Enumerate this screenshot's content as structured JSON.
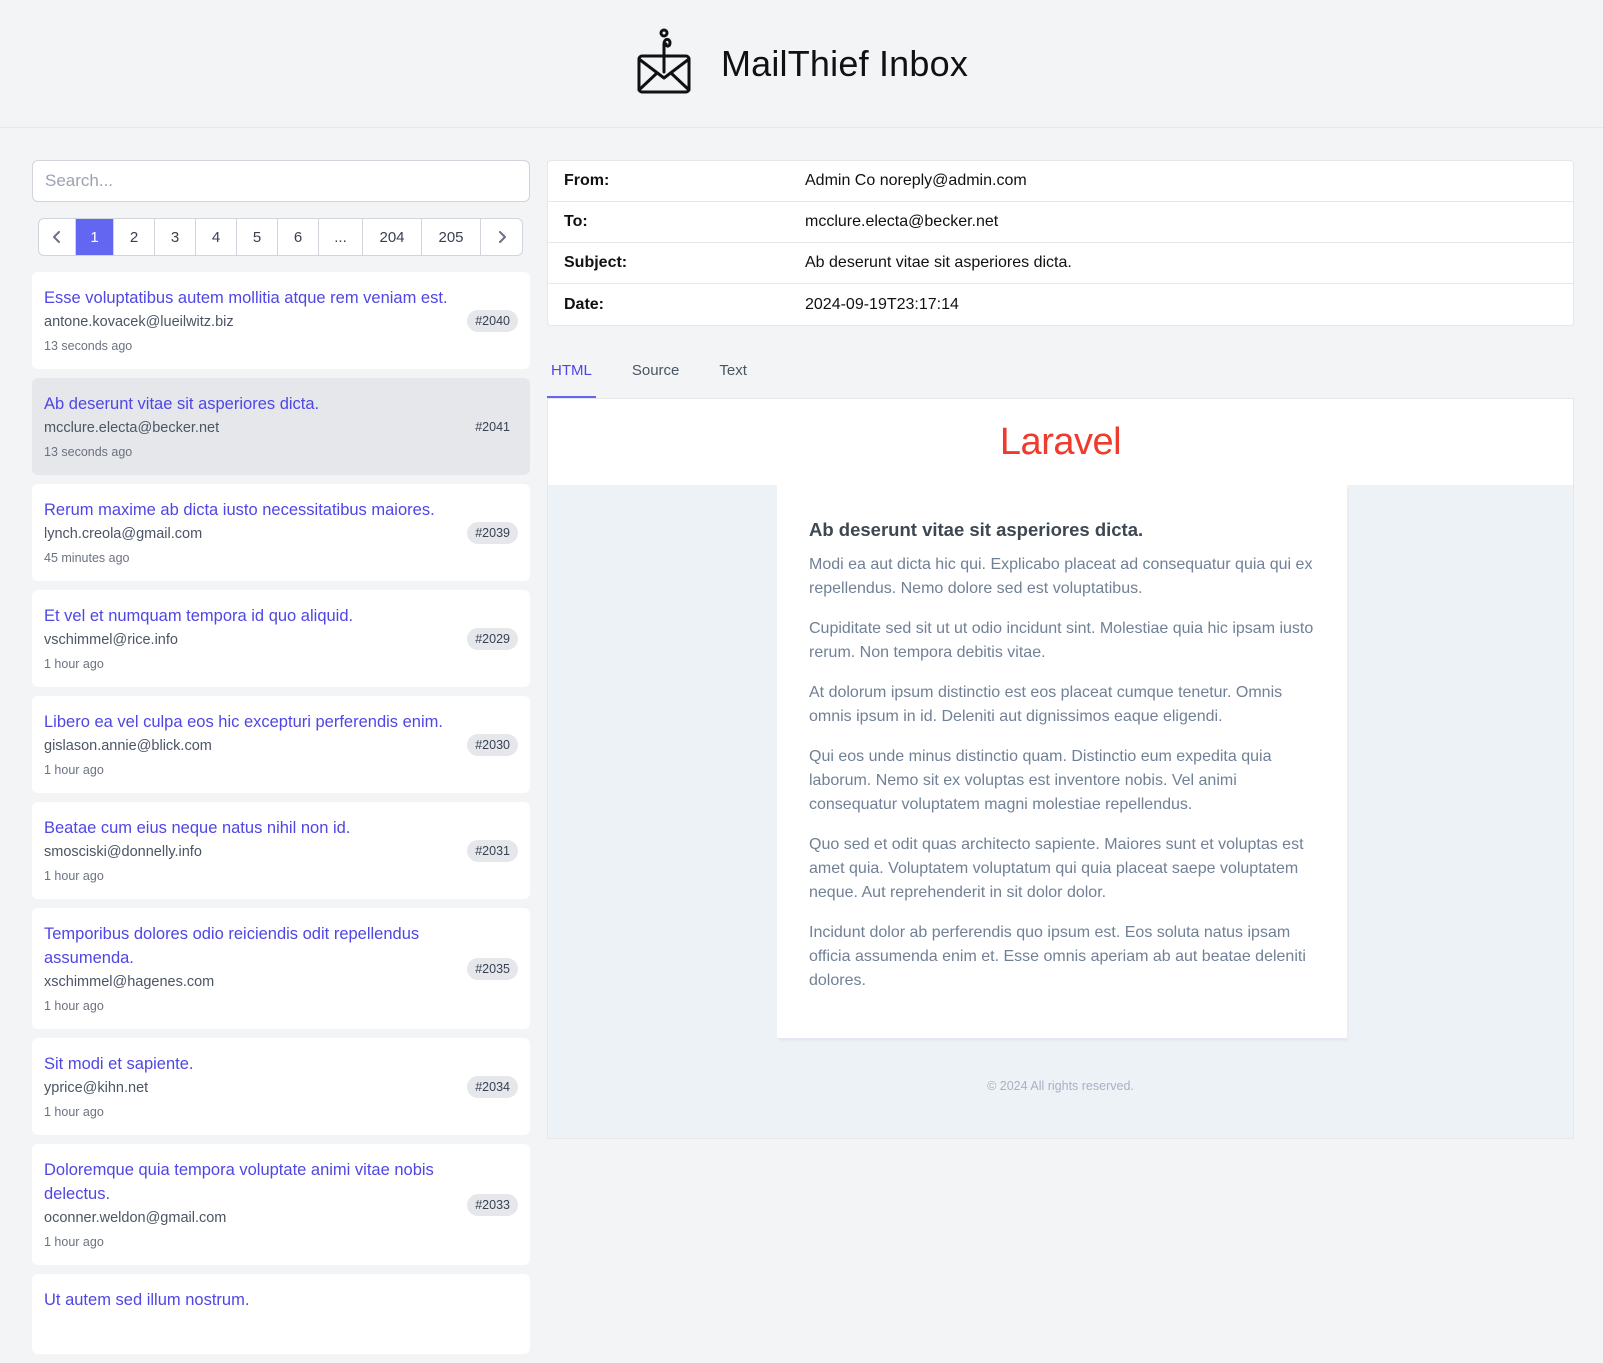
{
  "app": {
    "title": "MailThief Inbox"
  },
  "search": {
    "placeholder": "Search..."
  },
  "pagination": {
    "prev": "‹",
    "next": "›",
    "pages": [
      "1",
      "2",
      "3",
      "4",
      "5",
      "6",
      "...",
      "204",
      "205"
    ],
    "current": "1"
  },
  "mails": [
    {
      "subject": "Esse voluptatibus autem mollitia atque rem veniam est.",
      "from": "antone.kovacek@lueilwitz.biz",
      "time": "13 seconds ago",
      "id": "#2040"
    },
    {
      "subject": "Ab deserunt vitae sit asperiores dicta.",
      "from": "mcclure.electa@becker.net",
      "time": "13 seconds ago",
      "id": "#2041"
    },
    {
      "subject": "Rerum maxime ab dicta iusto necessitatibus maiores.",
      "from": "lynch.creola@gmail.com",
      "time": "45 minutes ago",
      "id": "#2039"
    },
    {
      "subject": "Et vel et numquam tempora id quo aliquid.",
      "from": "vschimmel@rice.info",
      "time": "1 hour ago",
      "id": "#2029"
    },
    {
      "subject": "Libero ea vel culpa eos hic excepturi perferendis enim.",
      "from": "gislason.annie@blick.com",
      "time": "1 hour ago",
      "id": "#2030"
    },
    {
      "subject": "Beatae cum eius neque natus nihil non id.",
      "from": "smosciski@donnelly.info",
      "time": "1 hour ago",
      "id": "#2031"
    },
    {
      "subject": "Temporibus dolores odio reiciendis odit repellendus assumenda.",
      "from": "xschimmel@hagenes.com",
      "time": "1 hour ago",
      "id": "#2035"
    },
    {
      "subject": "Sit modi et sapiente.",
      "from": "yprice@kihn.net",
      "time": "1 hour ago",
      "id": "#2034"
    },
    {
      "subject": "Doloremque quia tempora voluptate animi vitae nobis delectus.",
      "from": "oconner.weldon@gmail.com",
      "time": "1 hour ago",
      "id": "#2033"
    },
    {
      "subject": "Ut autem sed illum nostrum.",
      "from": "",
      "time": "",
      "id": ""
    }
  ],
  "message": {
    "from_label": "From:",
    "from": "Admin Co noreply@admin.com",
    "to_label": "To:",
    "to": "mcclure.electa@becker.net",
    "subject_label": "Subject:",
    "subject": "Ab deserunt vitae sit asperiores dicta.",
    "date_label": "Date:",
    "date": "2024-09-19T23:17:14"
  },
  "tabs": [
    "HTML",
    "Source",
    "Text"
  ],
  "preview": {
    "brand": "Laravel",
    "heading": "Ab deserunt vitae sit asperiores dicta.",
    "paragraphs": [
      "Modi ea aut dicta hic qui. Explicabo placeat ad consequatur quia qui ex repellendus. Nemo dolore sed est voluptatibus.",
      "Cupiditate sed sit ut ut odio incidunt sint. Molestiae quia hic ipsam iusto rerum. Non tempora debitis vitae.",
      "At dolorum ipsum distinctio est eos placeat cumque tenetur. Omnis omnis ipsum in id. Deleniti aut dignissimos eaque eligendi.",
      "Qui eos unde minus distinctio quam. Distinctio eum expedita quia laborum. Nemo sit ex voluptas est inventore nobis. Vel animi consequatur voluptatem magni molestiae repellendus.",
      "Quo sed et odit quas architecto sapiente. Maiores sunt et voluptas est amet quia. Voluptatem voluptatum qui quia placeat saepe voluptatem neque. Aut reprehenderit in sit dolor dolor.",
      "Incidunt dolor ab perferendis quo ipsum est. Eos soluta natus ipsam officia assumenda enim et. Esse omnis aperiam ab aut beatae deleniti dolores."
    ],
    "footer": "© 2024 All rights reserved."
  },
  "colors": {
    "accent": "#6366f1",
    "link": "#4f46e5",
    "brand": "#ef3b2d"
  },
  "icons": {
    "logo": "envelope-hook-icon"
  }
}
